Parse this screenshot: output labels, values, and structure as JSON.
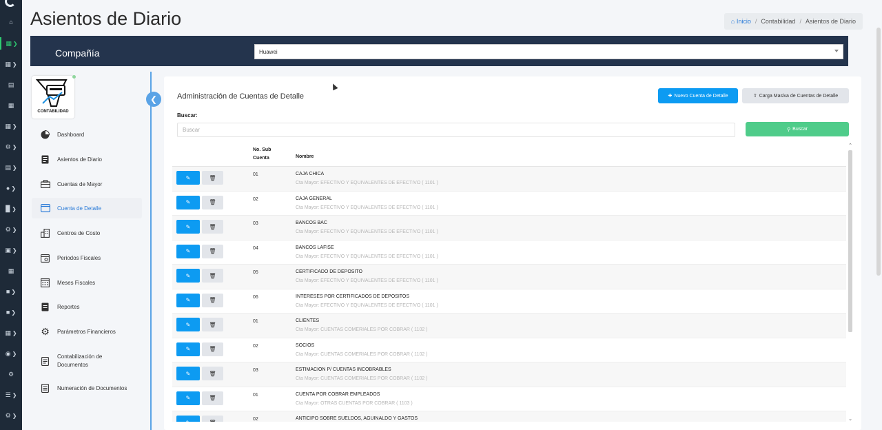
{
  "page": {
    "title": "Asientos de Diario"
  },
  "breadcrumb": {
    "home": "Inicio",
    "items": [
      "Contabilidad",
      "Asientos de Diario"
    ]
  },
  "company": {
    "label": "Compañía",
    "selected": "Huawei"
  },
  "brand": {
    "logo_text": "CONTABILIDAD"
  },
  "sidebar": {
    "items": [
      {
        "label": "Dashboard",
        "icon": "pie-chart-icon"
      },
      {
        "label": "Asientos de Diario",
        "icon": "document-icon"
      },
      {
        "label": "Cuentas de Mayor",
        "icon": "briefcase-icon"
      },
      {
        "label": "Cuenta de Detalle",
        "icon": "window-icon",
        "active": true
      },
      {
        "label": "Centros de Costo",
        "icon": "building-icon"
      },
      {
        "label": "Periodos Fiscales",
        "icon": "calendar-icon"
      },
      {
        "label": "Meses Fiscales",
        "icon": "grid-calendar-icon"
      },
      {
        "label": "Reportes",
        "icon": "report-icon"
      },
      {
        "label": "Parámetros Financieros",
        "icon": "gear-icon"
      },
      {
        "label": "Contabilización de Documentos",
        "icon": "document-outline-icon"
      },
      {
        "label": "Numeración de Documentos",
        "icon": "document-list-icon"
      }
    ]
  },
  "main": {
    "title": "Administración de Cuentas de Detalle",
    "new_button": "Nuevo Cuenta de Detalle",
    "upload_button": "Carga Masiva de Cuentas de Detalle",
    "search_label": "Buscar:",
    "search_placeholder": "Buscar",
    "search_button": "Buscar",
    "columns": {
      "num": "No. Sub Cuenta",
      "num_l1": "No. Sub",
      "num_l2": "Cuenta",
      "name": "Nombre"
    },
    "rows": [
      {
        "num": "01",
        "name": "CAJA CHICA",
        "sub": "Cta Mayor: EFECTIVO Y EQUIVALENTES DE EFECTIVO ( 1101 )"
      },
      {
        "num": "02",
        "name": "CAJA GENERAL",
        "sub": "Cta Mayor: EFECTIVO Y EQUIVALENTES DE EFECTIVO ( 1101 )"
      },
      {
        "num": "03",
        "name": "BANCOS BAC",
        "sub": "Cta Mayor: EFECTIVO Y EQUIVALENTES DE EFECTIVO ( 1101 )"
      },
      {
        "num": "04",
        "name": "BANCOS LAFISE",
        "sub": "Cta Mayor: EFECTIVO Y EQUIVALENTES DE EFECTIVO ( 1101 )"
      },
      {
        "num": "05",
        "name": "CERTIFICADO DE DEPOSITO",
        "sub": "Cta Mayor: EFECTIVO Y EQUIVALENTES DE EFECTIVO ( 1101 )"
      },
      {
        "num": "06",
        "name": "INTERESES POR CERTIFICADOS DE DEPOSITOS",
        "sub": "Cta Mayor: EFECTIVO Y EQUIVALENTES DE EFECTIVO ( 1101 )"
      },
      {
        "num": "01",
        "name": "CLIENTES",
        "sub": "Cta Mayor: CUENTAS COMERIALES POR COBRAR ( 1102 )"
      },
      {
        "num": "02",
        "name": "SOCIOS",
        "sub": "Cta Mayor: CUENTAS COMERIALES POR COBRAR ( 1102 )"
      },
      {
        "num": "03",
        "name": "ESTIMACION P/ CUENTAS INCOBRABLES",
        "sub": "Cta Mayor: CUENTAS COMERIALES POR COBRAR ( 1102 )"
      },
      {
        "num": "01",
        "name": "CUENTA POR COBRAR EMPLEADOS",
        "sub": "Cta Mayor: OTRAS CUENTAS POR COBRAR ( 1103 )"
      },
      {
        "num": "02",
        "name": "ANTICIPO SOBRE SUELDOS, AGUINALDO Y GASTOS",
        "sub": ""
      }
    ]
  }
}
